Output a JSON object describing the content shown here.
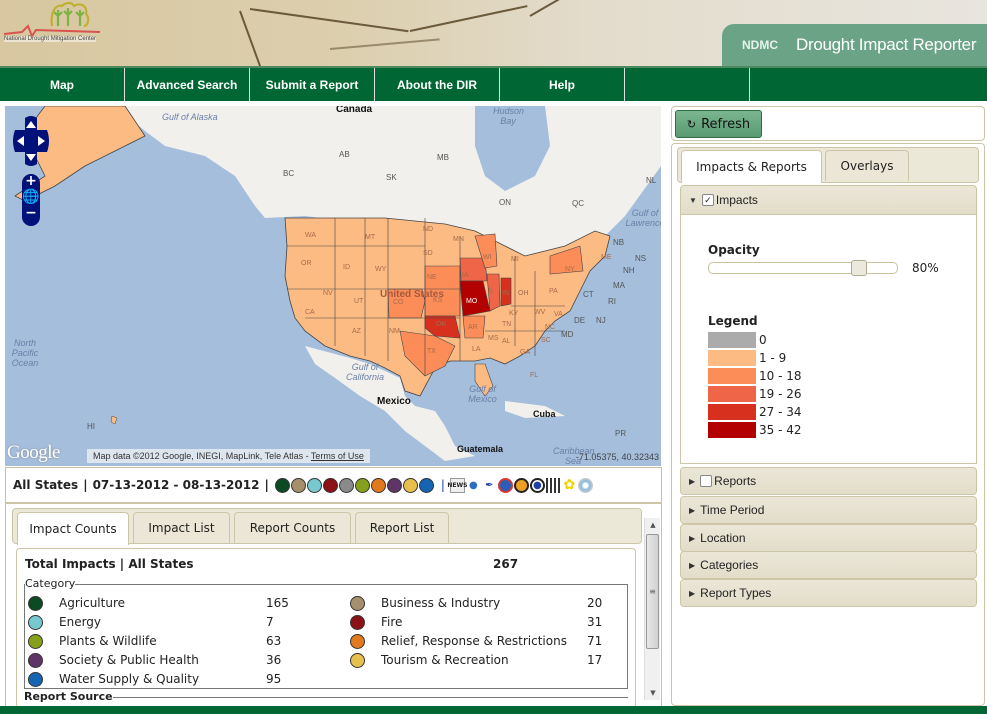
{
  "header": {
    "logo_text": "National  Drought Mitigation Center",
    "org_abbrev": "NDMC",
    "app_title": "Drought Impact Reporter"
  },
  "nav": {
    "items": [
      {
        "label": "Map"
      },
      {
        "label": "Advanced Search"
      },
      {
        "label": "Submit a Report"
      },
      {
        "label": "About the DIR"
      },
      {
        "label": "Help"
      },
      {
        "label": ""
      }
    ]
  },
  "map": {
    "labels": {
      "canada": "Canada",
      "us": "United States",
      "mexico": "Mexico",
      "cuba": "Cuba",
      "guatemala": "Guatemala",
      "gulf_alaska": "Gulf of Alaska",
      "hudson_bay": "Hudson Bay",
      "gulf_california": "Gulf of California",
      "gulf_mexico": "Gulf of Mexico",
      "north_pacific": "North Pacific Ocean",
      "caribbean": "Caribbean Sea",
      "gulf_lawrence": "Gulf of Lawrence",
      "provinces": [
        "BC",
        "AB",
        "SK",
        "MB",
        "ON",
        "QC",
        "NL",
        "NB",
        "NS",
        "PR",
        "HI"
      ],
      "states": [
        "WA",
        "OR",
        "CA",
        "ID",
        "NV",
        "MT",
        "WY",
        "UT",
        "AZ",
        "CO",
        "NM",
        "ND",
        "SD",
        "NE",
        "KS",
        "OK",
        "TX",
        "MN",
        "IA",
        "MO",
        "AR",
        "LA",
        "WI",
        "IL",
        "MI",
        "IN",
        "OH",
        "KY",
        "TN",
        "MS",
        "AL",
        "GA",
        "FL",
        "SC",
        "NC",
        "VA",
        "WV",
        "PA",
        "NY",
        "ME",
        "NH",
        "MA",
        "RI",
        "CT",
        "NJ",
        "DE",
        "MD"
      ]
    },
    "state_counts_class": {
      "MO": "35 - 42",
      "OK": "27 - 34",
      "IN": "27 - 34",
      "IA": "19 - 26",
      "IL": "19 - 26",
      "WI": "10 - 18",
      "NY": "10 - 18",
      "CO": "10 - 18",
      "NE": "10 - 18",
      "KS": "10 - 18",
      "TX": "10 - 18",
      "AR": "10 - 18"
    },
    "google_logo": "Google",
    "attribution": "Map data ©2012 Google, INEGI, MapLink, Tele Atlas - ",
    "terms_link": "Terms of Use",
    "coords": "-71.05375, 40.32343",
    "pan_control": "pan-control",
    "zoom_in": "+",
    "zoom_out": "−"
  },
  "filter_bar": {
    "state": "All States",
    "sep": "|",
    "date_range": "07-13-2012 - 08-13-2012",
    "category_colors": [
      "#0b4a22",
      "#a58f6d",
      "#78c8cf",
      "#8b1217",
      "#8a8a8a",
      "#86a01c",
      "#e07a1d",
      "#5e3566",
      "#e6bf4d",
      "#1565b3"
    ]
  },
  "bottom_tabs": [
    {
      "label": "Impact Counts",
      "active": true
    },
    {
      "label": "Impact List"
    },
    {
      "label": "Report Counts"
    },
    {
      "label": "Report List"
    }
  ],
  "impact_counts": {
    "total_label": "Total Impacts | All States",
    "total_value": "267",
    "category_legend": "Category",
    "categories": [
      {
        "name": "Agriculture",
        "count": "165",
        "color": "#0b4a22"
      },
      {
        "name": "Energy",
        "count": "7",
        "color": "#78c8cf"
      },
      {
        "name": "Plants & Wildlife",
        "count": "63",
        "color": "#86a01c"
      },
      {
        "name": "Society & Public Health",
        "count": "36",
        "color": "#5e3566"
      },
      {
        "name": "Water Supply & Quality",
        "count": "95",
        "color": "#1565b3"
      },
      {
        "name": "Business & Industry",
        "count": "20",
        "color": "#a58f6d"
      },
      {
        "name": "Fire",
        "count": "31",
        "color": "#8b1217"
      },
      {
        "name": "Relief, Response & Restrictions",
        "count": "71",
        "color": "#e07a1d"
      },
      {
        "name": "Tourism & Recreation",
        "count": "17",
        "color": "#e6bf4d"
      }
    ],
    "report_source_legend": "Report Source"
  },
  "right_panel": {
    "refresh_label": "Refresh",
    "tabs": [
      {
        "label": "Impacts & Reports",
        "active": true
      },
      {
        "label": "Overlays"
      }
    ],
    "impacts_section": {
      "label": "Impacts",
      "checked": true,
      "opacity_label": "Opacity",
      "opacity_value": 0.8,
      "opacity_text": "80%",
      "legend_label": "Legend",
      "legend": [
        {
          "range": "0",
          "color": "#ababab"
        },
        {
          "range": "1 - 9",
          "color": "#fdbb84"
        },
        {
          "range": "10 - 18",
          "color": "#fc8d59"
        },
        {
          "range": "19 - 26",
          "color": "#ef6548"
        },
        {
          "range": "27 - 34",
          "color": "#d7301f"
        },
        {
          "range": "35 - 42",
          "color": "#b30000"
        }
      ]
    },
    "sections": [
      {
        "label": "Reports",
        "checkbox": true,
        "checked": false
      },
      {
        "label": "Time Period"
      },
      {
        "label": "Location"
      },
      {
        "label": "Categories"
      },
      {
        "label": "Report Types"
      }
    ]
  }
}
